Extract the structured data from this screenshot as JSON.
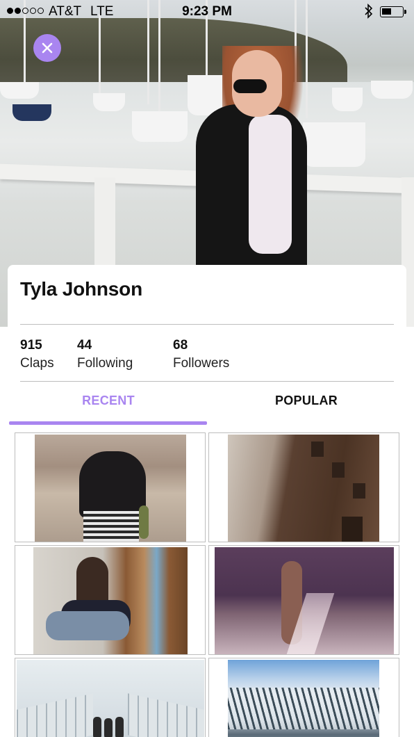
{
  "status_bar": {
    "carrier": "AT&T",
    "network": "LTE",
    "time": "9:23 PM",
    "signal_bars_filled": 2,
    "signal_bars_total": 5,
    "battery_level": 0.45
  },
  "profile": {
    "name": "Tyla Johnson",
    "stats": [
      {
        "value": "915",
        "label": "Claps"
      },
      {
        "value": "44",
        "label": "Following"
      },
      {
        "value": "68",
        "label": "Followers"
      }
    ]
  },
  "tabs": [
    {
      "label": "RECENT",
      "active": true
    },
    {
      "label": "POPULAR",
      "active": false
    }
  ],
  "colors": {
    "accent": "#a985f0",
    "text": "#111111",
    "divider": "#bdbdbd"
  },
  "icons": {
    "close": "close-icon",
    "bluetooth": "bluetooth-icon",
    "battery": "battery-icon"
  },
  "grid_photos": [
    {
      "subject": "woman-in-desert-photo"
    },
    {
      "subject": "city-building-photo"
    },
    {
      "subject": "woman-by-window-photo"
    },
    {
      "subject": "woman-in-alley-photo"
    },
    {
      "subject": "bridge-walkers-photo"
    },
    {
      "subject": "snowy-mountain-photo"
    }
  ]
}
